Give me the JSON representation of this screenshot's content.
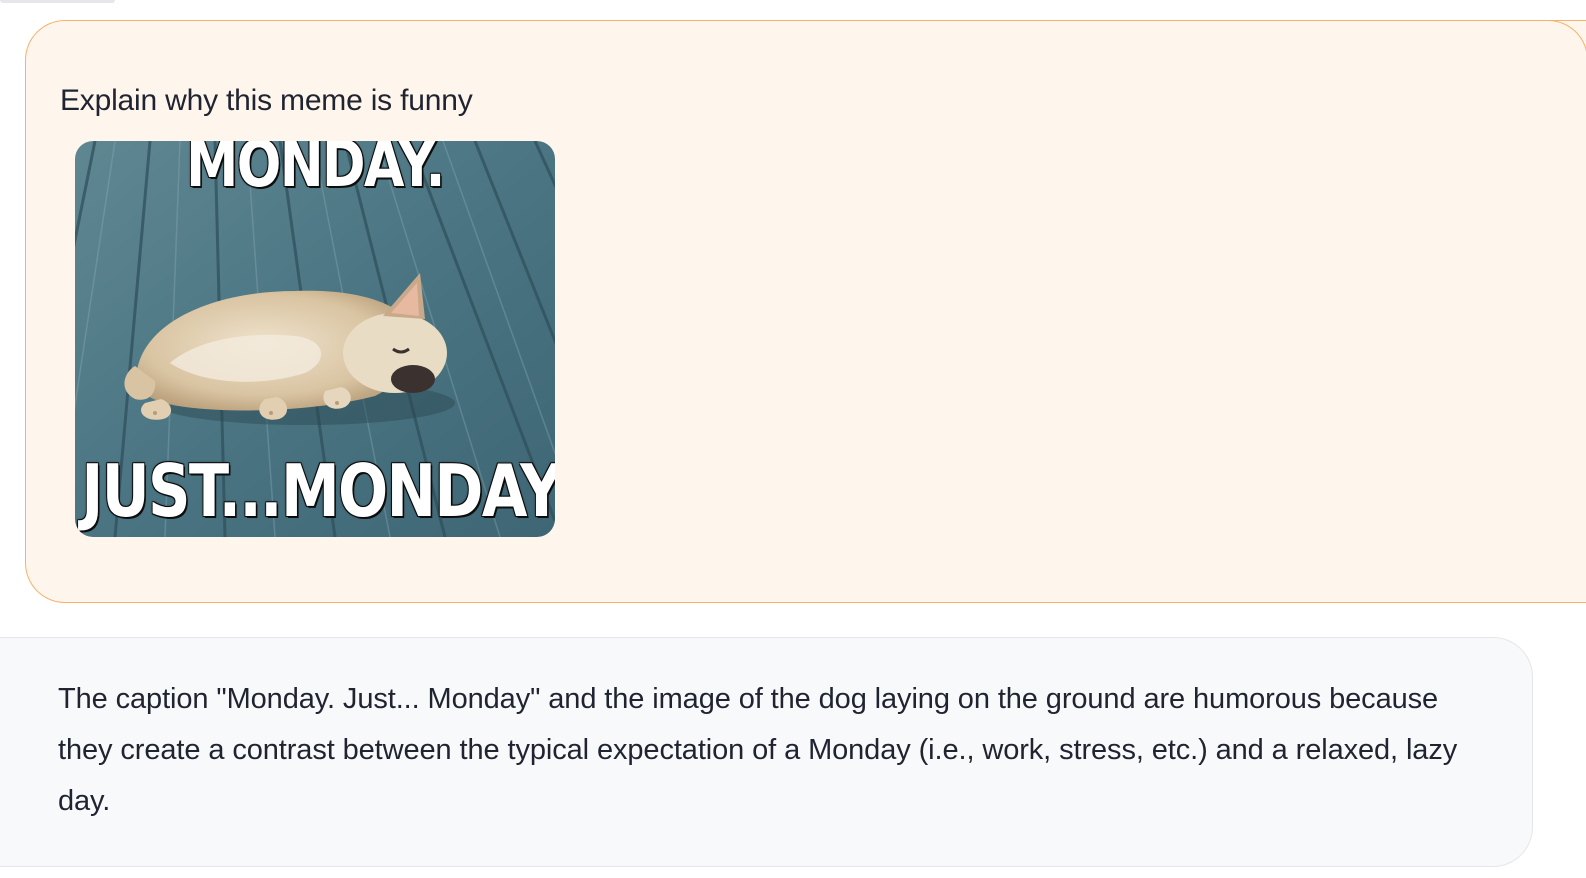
{
  "chat": {
    "user_message": {
      "text": "Explain why this meme is funny",
      "image": {
        "top_caption": "MONDAY.",
        "bottom_caption": "JUST...MONDAY."
      }
    },
    "assistant_message": {
      "text": "The caption \"Monday. Just... Monday\" and the image of the dog laying on the ground are humorous because they create a contrast between the typical expectation of a Monday (i.e., work, stress, etc.) and a relaxed, lazy day."
    }
  },
  "colors": {
    "user_bubble_bg": "#fef5ec",
    "user_bubble_border": "#f5b26b",
    "assistant_bubble_bg": "#f8f9fb",
    "assistant_bubble_border": "#e3e6ea"
  }
}
